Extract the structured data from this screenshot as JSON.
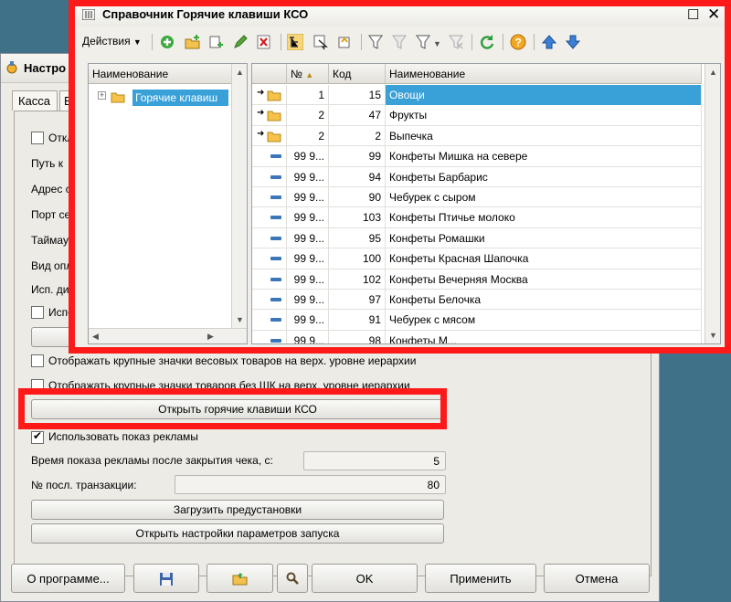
{
  "background_window": {
    "title": "Настро",
    "tabs": [
      "Касса",
      "Е"
    ],
    "partial_labels": [
      "Откл",
      "Путь к ",
      "Адрес с",
      "Порт се",
      "Таймау",
      "Вид опл",
      "Исп. ди",
      "Испо"
    ],
    "checkbox_texts": [
      "Отображать крупные значки весовых товаров на верх. уровне иерархии",
      "Отображать крупные значки товаров без ШК на верх. уровне иерархии",
      "Использовать показ рекламы"
    ],
    "open_hotkeys_button": "Открыть горячие клавиши КСО",
    "ad_time_label": "Время показа рекламы после закрытия чека, с:",
    "ad_time_value": "5",
    "last_transaction_label": "№ посл. транзакции:",
    "last_transaction_value": "80",
    "load_presets_button": "Загрузить предустановки",
    "open_startup_button": "Открыть настройки параметров запуска",
    "footer": {
      "about": "О программе...",
      "ok": "OK",
      "apply": "Применить",
      "cancel": "Отмена"
    }
  },
  "dialog": {
    "title": "Справочник Горячие клавиши КСО",
    "actions_label": "Действия",
    "tree_header": "Наименование",
    "tree_item": "Горячие клавиш",
    "grid_headers": {
      "num": "№",
      "code": "Код",
      "name": "Наименование"
    },
    "rows": [
      {
        "type": "folder",
        "num": "1",
        "code": "15",
        "name": "Овощи",
        "selected": true
      },
      {
        "type": "folder",
        "num": "2",
        "code": "47",
        "name": "Фрукты"
      },
      {
        "type": "folder",
        "num": "2",
        "code": "2",
        "name": "Выпечка"
      },
      {
        "type": "item",
        "num": "99 9...",
        "code": "99",
        "name": "Конфеты Мишка на севере"
      },
      {
        "type": "item",
        "num": "99 9...",
        "code": "94",
        "name": "Конфеты Барбарис"
      },
      {
        "type": "item",
        "num": "99 9...",
        "code": "90",
        "name": "Чебурек с сыром"
      },
      {
        "type": "item",
        "num": "99 9...",
        "code": "103",
        "name": "Конфеты Птичье молоко"
      },
      {
        "type": "item",
        "num": "99 9...",
        "code": "95",
        "name": "Конфеты Ромашки"
      },
      {
        "type": "item",
        "num": "99 9...",
        "code": "100",
        "name": "Конфеты Красная Шапочка"
      },
      {
        "type": "item",
        "num": "99 9...",
        "code": "102",
        "name": "Конфеты Вечерняя Москва"
      },
      {
        "type": "item",
        "num": "99 9...",
        "code": "97",
        "name": "Конфеты Белочка"
      },
      {
        "type": "item",
        "num": "99 9...",
        "code": "91",
        "name": "Чебурек с мясом"
      },
      {
        "type": "item",
        "num": "99 9...",
        "code": "98",
        "name": "Конфеты М..."
      }
    ]
  },
  "colors": {
    "highlight": "#ff1a1a",
    "selection": "#3aa0d8",
    "desktop": "#3f7188",
    "window_bg": "#ecebe6"
  }
}
